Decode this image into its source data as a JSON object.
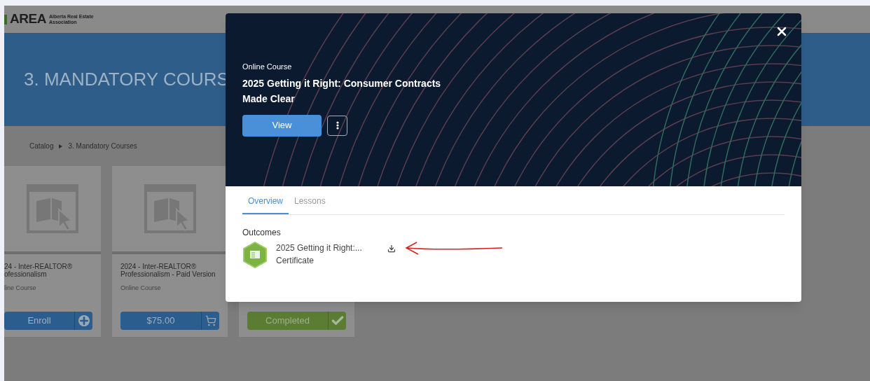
{
  "header": {
    "logo_text": "AREA",
    "logo_subtitle": [
      "Alberta Real Estate",
      "Association"
    ]
  },
  "banner": {
    "title": "3. MANDATORY COURS"
  },
  "breadcrumb": [
    "Catalog",
    "3. Mandatory Courses"
  ],
  "cards": [
    {
      "title": [
        "24 - Inter-REALTOR®",
        "ofessionalism"
      ],
      "type": "line Course",
      "action": {
        "kind": "enroll",
        "label": "Enroll"
      }
    },
    {
      "title": [
        "2024 - Inter-REALTOR®",
        "Professionalism - Paid Version"
      ],
      "type": "Online Course",
      "action": {
        "kind": "purchase",
        "label": "$75.00"
      }
    },
    {
      "action": {
        "kind": "completed",
        "label": "Completed"
      }
    }
  ],
  "modal": {
    "type": "Online Course",
    "title": [
      "2025 Getting it Right: Consumer Contracts",
      "Made Clear"
    ],
    "primary_button": "View",
    "tabs": [
      {
        "label": "Overview",
        "selected": true
      },
      {
        "label": "Lessons",
        "selected": false
      }
    ],
    "outcomes": {
      "heading": "Outcomes",
      "items": [
        {
          "title": "2025 Getting it Right:...",
          "subtitle": "Certificate"
        }
      ]
    }
  }
}
